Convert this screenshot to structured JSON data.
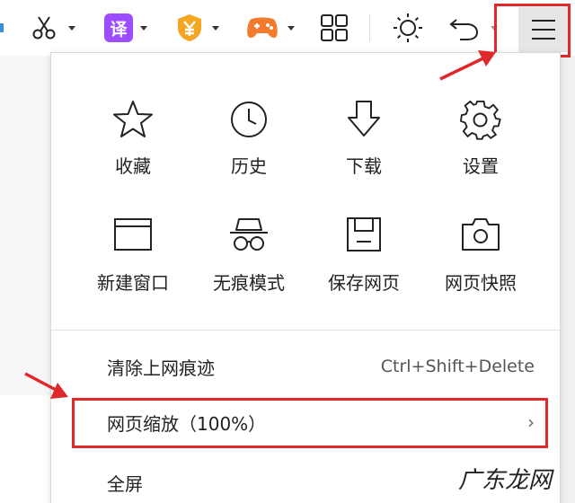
{
  "toolbar": {
    "translate_glyph": "译",
    "icons": [
      "scissors-icon",
      "translate-icon",
      "shield-badge-icon",
      "game-controller-icon",
      "grid-apps-icon",
      "sun-icon",
      "undo-icon",
      "menu-icon"
    ]
  },
  "menu": {
    "grid": [
      {
        "label": "收藏",
        "icon": "star-icon"
      },
      {
        "label": "历史",
        "icon": "clock-icon"
      },
      {
        "label": "下载",
        "icon": "download-icon"
      },
      {
        "label": "设置",
        "icon": "gear-icon"
      },
      {
        "label": "新建窗口",
        "icon": "window-icon"
      },
      {
        "label": "无痕模式",
        "icon": "incognito-icon"
      },
      {
        "label": "保存网页",
        "icon": "save-icon"
      },
      {
        "label": "网页快照",
        "icon": "camera-icon"
      }
    ],
    "clear_history": {
      "label": "清除上网痕迹",
      "shortcut": "Ctrl+Shift+Delete"
    },
    "zoom": {
      "label": "网页缩放（100%）",
      "chevron": "›"
    },
    "fullscreen": {
      "label": "全屏"
    }
  },
  "watermark": "广东龙网",
  "colors": {
    "highlight_red": "#e0282b",
    "translate_purple": "#9b4dff",
    "shield_orange": "#f5a623",
    "game_orange": "#f47a2c"
  }
}
